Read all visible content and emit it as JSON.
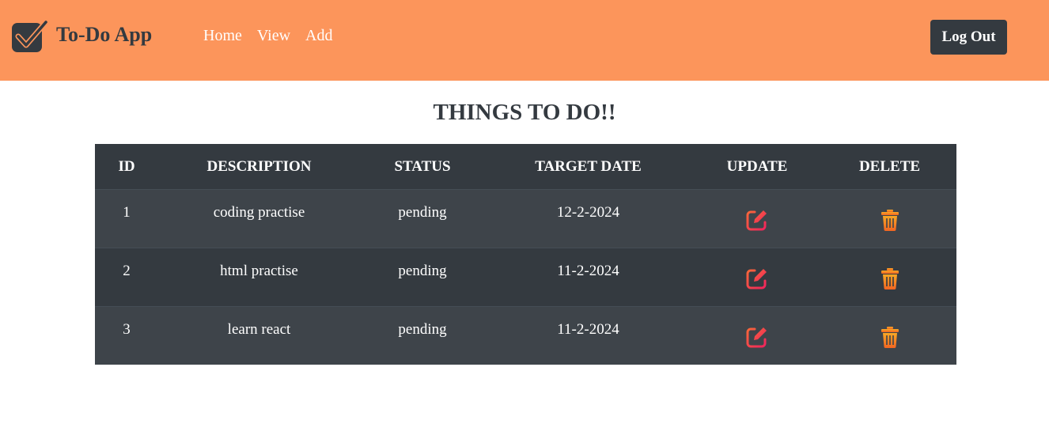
{
  "app": {
    "name": "To-Do App",
    "brand_icon": "checkbox-check-icon",
    "colors": {
      "navbar": "#fc955b",
      "dark": "#343a40",
      "row_alt": "#3e444a",
      "edit_icon": "#f0304f",
      "delete_icon": "#f7941d"
    }
  },
  "nav": {
    "links": [
      {
        "label": "Home"
      },
      {
        "label": "View"
      },
      {
        "label": "Add"
      }
    ],
    "logout_label": "Log Out"
  },
  "main": {
    "title": "THINGS TO DO!!",
    "table": {
      "headers": [
        "ID",
        "DESCRIPTION",
        "STATUS",
        "TARGET DATE",
        "UPDATE",
        "DELETE"
      ],
      "rows": [
        {
          "id": "1",
          "description": "coding practise",
          "status": "pending",
          "target_date": "12-2-2024",
          "update_icon": "edit-icon",
          "delete_icon": "trash-icon"
        },
        {
          "id": "2",
          "description": "html practise",
          "status": "pending",
          "target_date": "11-2-2024",
          "update_icon": "edit-icon",
          "delete_icon": "trash-icon"
        },
        {
          "id": "3",
          "description": "learn react",
          "status": "pending",
          "target_date": "11-2-2024",
          "update_icon": "edit-icon",
          "delete_icon": "trash-icon"
        }
      ]
    }
  }
}
